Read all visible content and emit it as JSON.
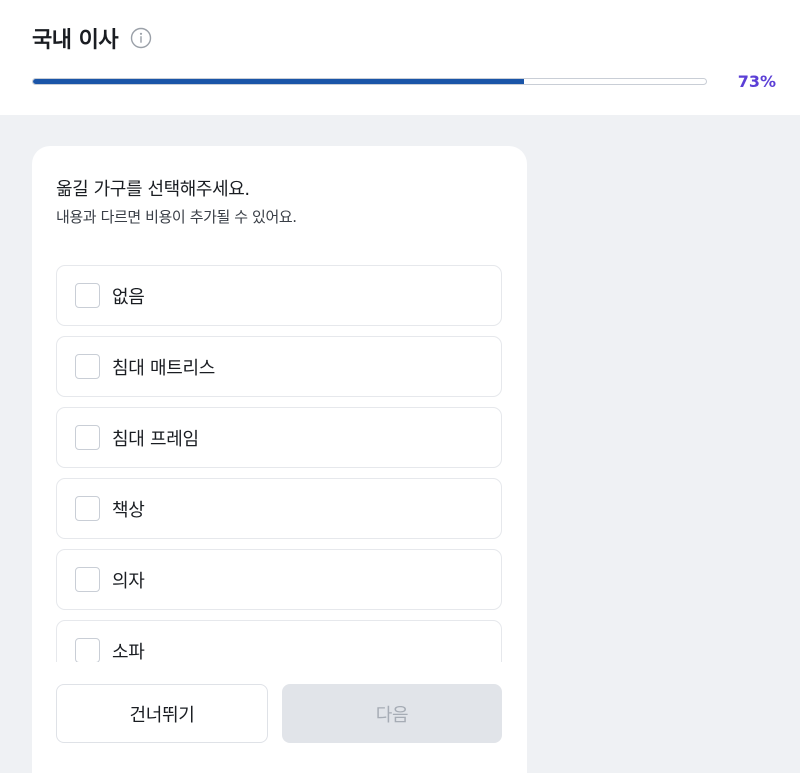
{
  "header": {
    "title": "국내 이사",
    "info_icon": "info-icon",
    "progress_percent": 73,
    "progress_label": "73%"
  },
  "question": {
    "title": "옮길 가구를 선택해주세요.",
    "subtitle": "내용과 다르면 비용이 추가될 수 있어요."
  },
  "options": [
    {
      "label": "없음",
      "checked": false
    },
    {
      "label": "침대 매트리스",
      "checked": false
    },
    {
      "label": "침대 프레임",
      "checked": false
    },
    {
      "label": "책상",
      "checked": false
    },
    {
      "label": "의자",
      "checked": false
    },
    {
      "label": "소파",
      "checked": false
    }
  ],
  "actions": {
    "skip_label": "건너뛰기",
    "next_label": "다음",
    "next_enabled": false
  },
  "colors": {
    "progress_fill": "#1a55a8",
    "percent_text": "#5b3fd6",
    "background": "#eff1f4",
    "disabled_button": "#e1e4e9"
  }
}
